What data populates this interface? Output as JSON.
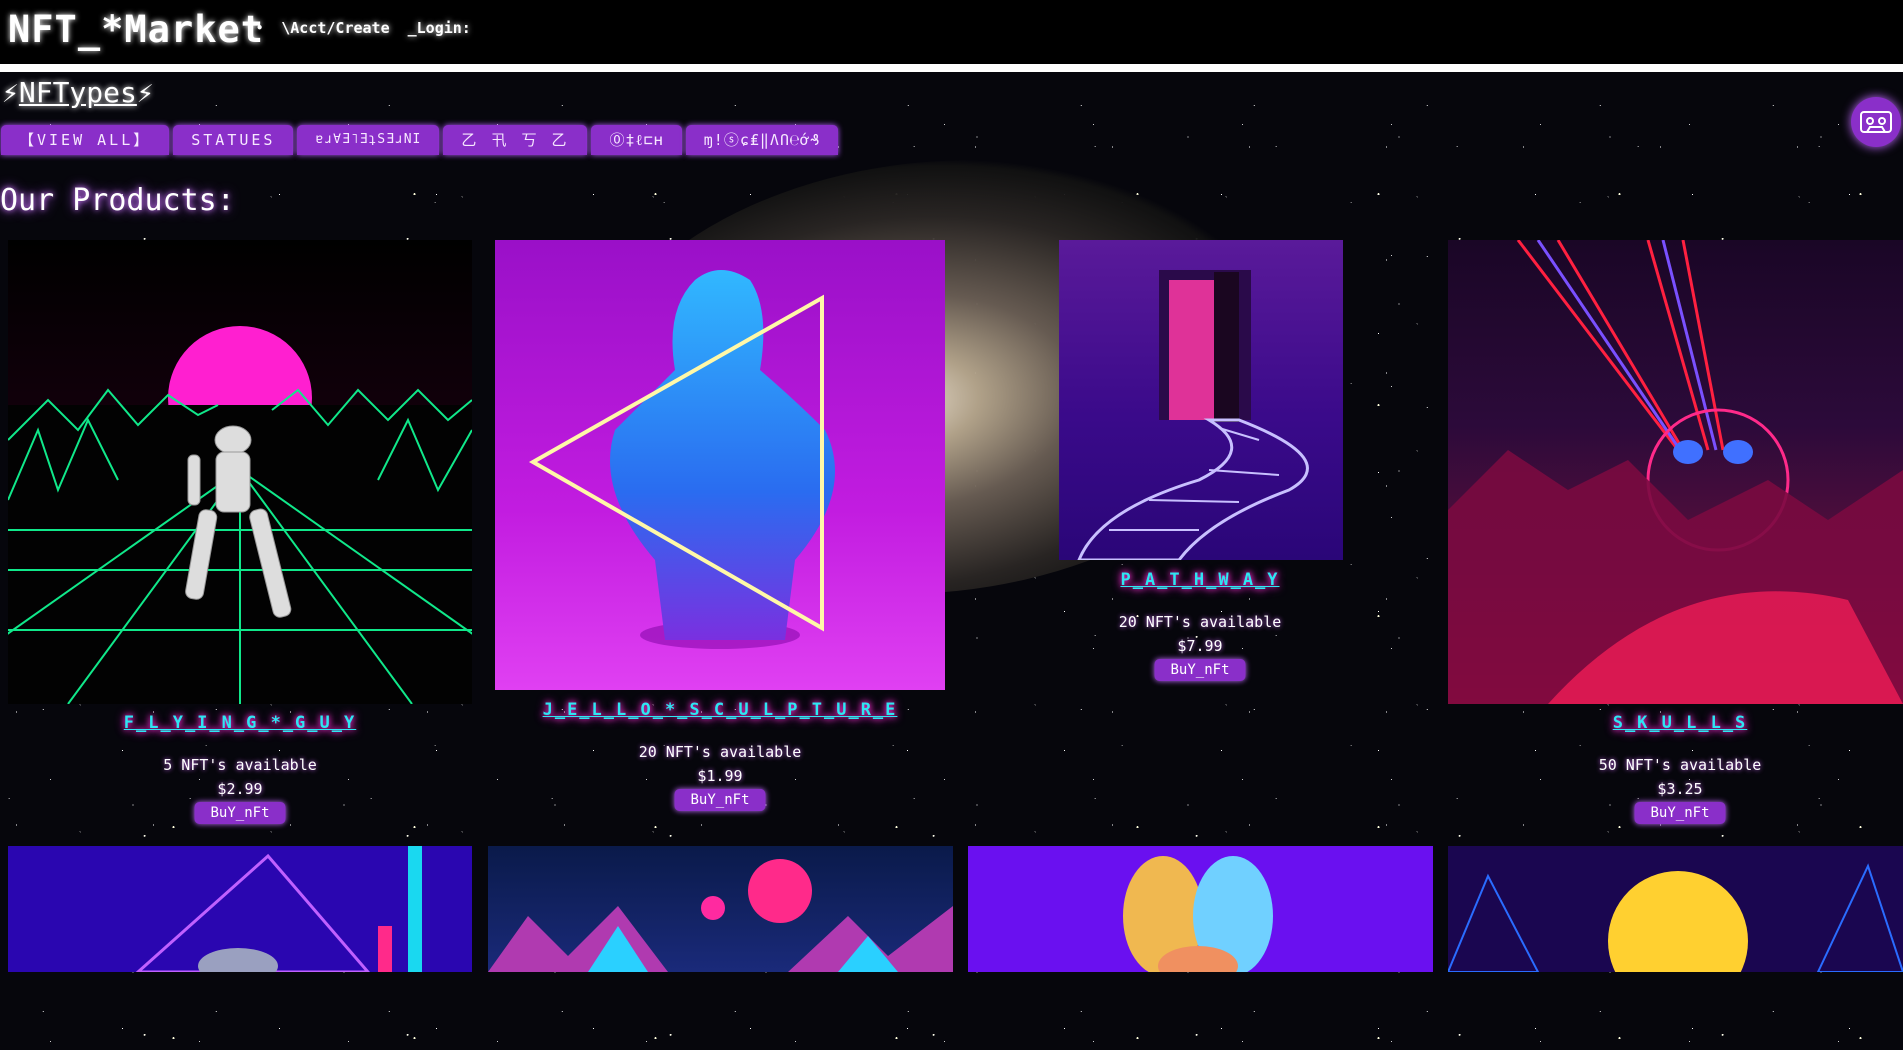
{
  "brand": "NFT_*Market",
  "top_nav": {
    "account": "\\Acct/Create",
    "login": "_Login:"
  },
  "types_label": "NFTypes",
  "categories": [
    "【VIEW ALL】",
    "STATUES",
    "ɐɹ∀Ǝ˥ƎʇSƎɹNI",
    "乙 卂 丂 乙",
    "⓪‡ℓ⊏ʜ",
    "ɱ!ⓢɕ₤‖ɅՈ℮ớ₰"
  ],
  "heading": "Our Products:",
  "products": [
    {
      "name": "F_L_Y_I_N_G_*_G_U_Y",
      "available": "5 NFT's available",
      "price": "$2.99",
      "button": "BuY_nFt"
    },
    {
      "name": "J_E_L_L_O_*_S_C_U_L_P_T_U_R_E",
      "available": "20 NFT's available",
      "price": "$1.99",
      "button": "BuY_nFt"
    },
    {
      "name": "P_A_T_H_W_A_Y",
      "available": "20 NFT's available",
      "price": "$7.99",
      "button": "BuY_nFt"
    },
    {
      "name": "S_K_U_L_L_S",
      "available": "50 NFT's available",
      "price": "$3.25",
      "button": "BuY_nFt"
    }
  ],
  "colors": {
    "accent_purple": "#8a2fc9",
    "title_cyan": "#2ee6f2",
    "glow_pink": "#ff2bd6",
    "background": "#06060c"
  },
  "icons": [
    "lightning-icon",
    "cassette-tape-icon"
  ]
}
